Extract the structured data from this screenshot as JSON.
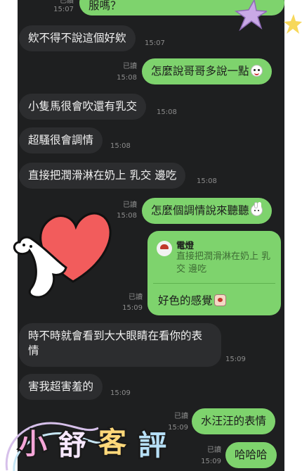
{
  "messages": [
    {
      "id": "m0",
      "side": "out",
      "text": "服嗎？",
      "read": "已讀",
      "time": "15:07"
    },
    {
      "id": "m1",
      "side": "in",
      "text": "欸不得不說這個好欸",
      "time": "15:07"
    },
    {
      "id": "m2",
      "side": "out",
      "text": "怎麼說哥哥多說一點",
      "emoji": "smile-emoji",
      "read": "已讀",
      "time": "15:08"
    },
    {
      "id": "m3",
      "side": "in",
      "text": "小隻馬很會吹還有乳交",
      "time": "15:08"
    },
    {
      "id": "m4",
      "side": "in",
      "text": "超騷很會調情",
      "time": "15:08"
    },
    {
      "id": "m5",
      "side": "in",
      "text": "直接把潤滑淋在奶上 乳交 邊吃",
      "time": "15:08"
    },
    {
      "id": "m6",
      "side": "out",
      "text": "怎麼個調情說來聽聽",
      "emoji": "bunny-emoji",
      "read": "已讀",
      "time": "15:08"
    },
    {
      "id": "m7",
      "side": "out",
      "type": "reply",
      "quoted_name": "電燈",
      "quoted_text": "直接把潤滑淋在奶上 乳交 邊吃",
      "text": "好色的感覺",
      "emoji": "cup-emoji",
      "read": "已讀",
      "time": "15:09"
    },
    {
      "id": "m8",
      "side": "in",
      "text": "時不時就會看到大大眼睛在看你的表情",
      "time": "15:09"
    },
    {
      "id": "m9",
      "side": "in",
      "text": "害我超害羞的",
      "time": "15:09"
    },
    {
      "id": "m10",
      "side": "out",
      "text": "水汪汪的表情",
      "read": "已讀",
      "time": "15:09"
    },
    {
      "id": "m11",
      "side": "out",
      "text": "哈哈哈",
      "read": "已讀",
      "time": "15:09"
    }
  ],
  "stamp": {
    "text": "小舒客評"
  },
  "colors": {
    "chat_bg": "#1e1f20",
    "incoming": "#2c2d2f",
    "outgoing": "#7ed36d",
    "heart": "#f25c5c"
  }
}
